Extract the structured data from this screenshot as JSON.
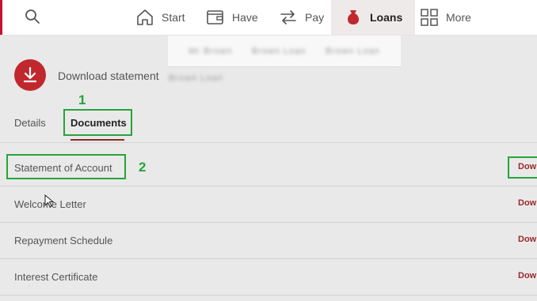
{
  "nav": {
    "start": "Start",
    "have": "Have",
    "pay": "Pay",
    "loans": "Loans",
    "more": "More"
  },
  "popup": {
    "blurred_1": "Mr Brown",
    "blurred_2": "Brown Loan",
    "blurred_3": "Brown Loan"
  },
  "download": {
    "label": "Download statement"
  },
  "tabs": [
    {
      "label": "Details"
    },
    {
      "label": "Documents"
    }
  ],
  "documents": [
    {
      "name": "Statement of Account",
      "action": "Download"
    },
    {
      "name": "Welcome Letter",
      "action": "Download"
    },
    {
      "name": "Repayment Schedule",
      "action": "Download"
    },
    {
      "name": "Interest Certificate",
      "action": "Download"
    }
  ],
  "annotations": {
    "step1": "1",
    "step2": "2"
  },
  "colors": {
    "brand_red": "#c0282e",
    "highlight_green": "#27a33b"
  }
}
